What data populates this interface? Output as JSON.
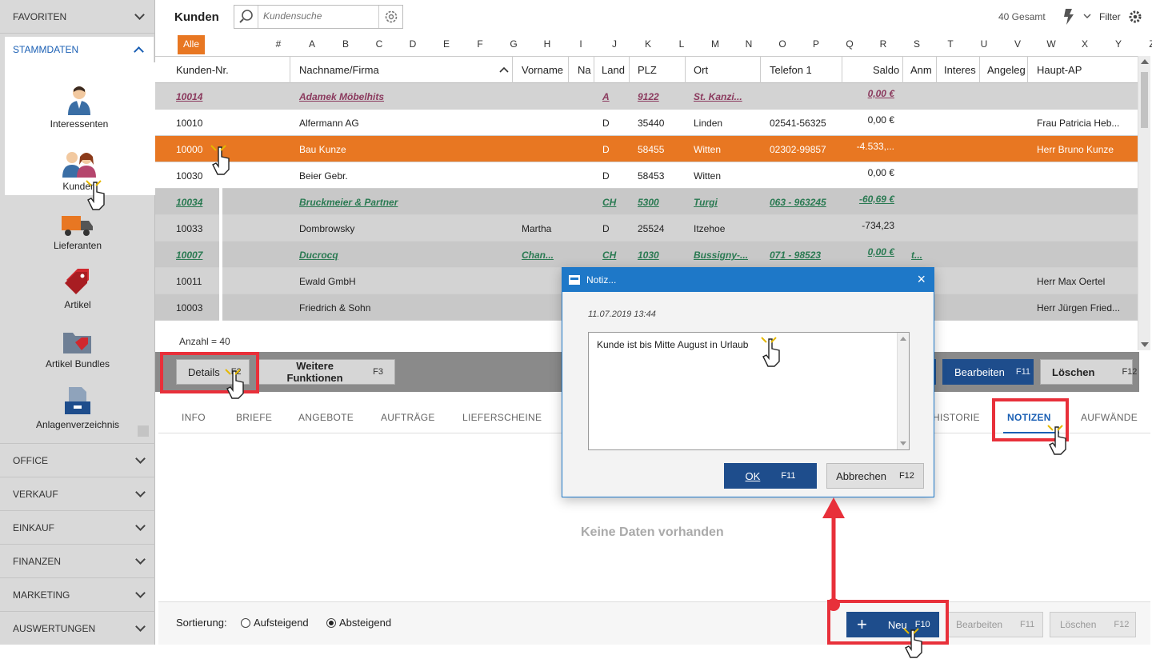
{
  "sidebar": {
    "favoriten": "FAVORITEN",
    "stammdaten": "STAMMDATEN",
    "items": [
      {
        "label": "Interessenten",
        "icon": "person-icon"
      },
      {
        "label": "Kunden",
        "icon": "customers-icon"
      },
      {
        "label": "Lieferanten",
        "icon": "truck-icon"
      },
      {
        "label": "Artikel",
        "icon": "tag-icon"
      },
      {
        "label": "Artikel Bundles",
        "icon": "folder-tag-icon"
      },
      {
        "label": "Anlagenverzeichnis",
        "icon": "archive-icon"
      }
    ],
    "sections": [
      "OFFICE",
      "VERKAUF",
      "EINKAUF",
      "FINANZEN",
      "MARKETING",
      "AUSWERTUNGEN"
    ]
  },
  "header": {
    "title": "Kunden",
    "search_placeholder": "Kundensuche",
    "total": "40 Gesamt",
    "filter": "Filter"
  },
  "alphabet": [
    "Alle",
    "#",
    "A",
    "B",
    "C",
    "D",
    "E",
    "F",
    "G",
    "H",
    "I",
    "J",
    "K",
    "L",
    "M",
    "N",
    "O",
    "P",
    "Q",
    "R",
    "S",
    "T",
    "U",
    "V",
    "W",
    "X",
    "Y",
    "Z"
  ],
  "table": {
    "columns": [
      "Kunden-Nr.",
      "Nachname/Firma",
      "Vorname",
      "Na",
      "Land",
      "PLZ",
      "Ort",
      "Telefon 1",
      "Saldo",
      "Anm",
      "Interes",
      "Angeleg",
      "Haupt-AP"
    ],
    "rows": [
      {
        "nr": "10014",
        "name": "Adamek Möbelhits",
        "vorname": "",
        "land": "A",
        "plz": "9122",
        "ort": "St. Kanzi...",
        "tel": "",
        "saldo": "0,00 €",
        "anm": "",
        "ap": ""
      },
      {
        "nr": "10010",
        "name": "Alfermann AG",
        "vorname": "",
        "land": "D",
        "plz": "35440",
        "ort": "Linden",
        "tel": "02541-56325",
        "saldo": "0,00 €",
        "anm": "",
        "ap": "Frau Patricia Heb..."
      },
      {
        "nr": "10000",
        "name": "Bau Kunze",
        "vorname": "",
        "land": "D",
        "plz": "58455",
        "ort": "Witten",
        "tel": "02302-99857",
        "saldo": "-4.533,...",
        "anm": "",
        "ap": "Herr Bruno Kunze"
      },
      {
        "nr": "10030",
        "name": "Beier Gebr.",
        "vorname": "",
        "land": "D",
        "plz": "58453",
        "ort": "Witten",
        "tel": "",
        "saldo": "0,00 €",
        "anm": "",
        "ap": ""
      },
      {
        "nr": "10034",
        "name": "Bruckmeier & Partner",
        "vorname": "",
        "land": "CH",
        "plz": "5300",
        "ort": "Turgi",
        "tel": "063 - 963245",
        "saldo": "-60,69 €",
        "anm": "",
        "ap": ""
      },
      {
        "nr": "10033",
        "name": "Dombrowsky",
        "vorname": "Martha",
        "land": "D",
        "plz": "25524",
        "ort": "Itzehoe",
        "tel": "",
        "saldo": "-734,23",
        "anm": "",
        "ap": ""
      },
      {
        "nr": "10007",
        "name": "Ducrocq",
        "vorname": "Chan...",
        "land": "CH",
        "plz": "1030",
        "ort": "Bussigny-...",
        "tel": "071 - 98523",
        "saldo": "0,00 €",
        "anm": "t...",
        "ap": ""
      },
      {
        "nr": "10011",
        "name": "Ewald GmbH",
        "vorname": "",
        "land": "",
        "plz": "",
        "ort": "",
        "tel": "",
        "saldo": "",
        "anm": "",
        "ap": "Herr Max Oertel"
      },
      {
        "nr": "10003",
        "name": "Friedrich & Sohn",
        "vorname": "",
        "land": "",
        "plz": "",
        "ort": "",
        "tel": "",
        "saldo": "",
        "anm": "",
        "ap": "Herr Jürgen Fried..."
      }
    ],
    "count": "Anzahl = 40"
  },
  "toolbar": {
    "details": "Details",
    "details_key": "F2",
    "weitere": "Weitere Funktionen",
    "weitere_key": "F3",
    "bearbeiten": "Bearbeiten",
    "bearbeiten_key": "F11",
    "loeschen": "Löschen",
    "loeschen_key": "F12"
  },
  "tabs": [
    "INFO",
    "BRIEFE",
    "ANGEBOTE",
    "AUFTRÄGE",
    "LIEFERSCHEINE",
    "HISTORIE",
    "NOTIZEN",
    "AUFWÄNDE"
  ],
  "empty": "Keine Daten vorhanden",
  "bottom": {
    "sort_label": "Sortierung:",
    "asc": "Aufsteigend",
    "desc": "Absteigend",
    "neu": "Neu",
    "neu_key": "F10",
    "bearbeiten": "Bearbeiten",
    "bearbeiten_key": "F11",
    "loeschen": "Löschen",
    "loeschen_key": "F12"
  },
  "dialog": {
    "title": "Notiz...",
    "date": "11.07.2019 13:44",
    "text": "Kunde ist bis Mitte August in Urlaub",
    "ok": "OK",
    "ok_key": "F11",
    "cancel": "Abbrechen",
    "cancel_key": "F12"
  },
  "colors": {
    "accent": "#e87722",
    "blue": "#1e4d8c",
    "title_blue": "#1e78c8",
    "annotation": "#e8303a"
  }
}
